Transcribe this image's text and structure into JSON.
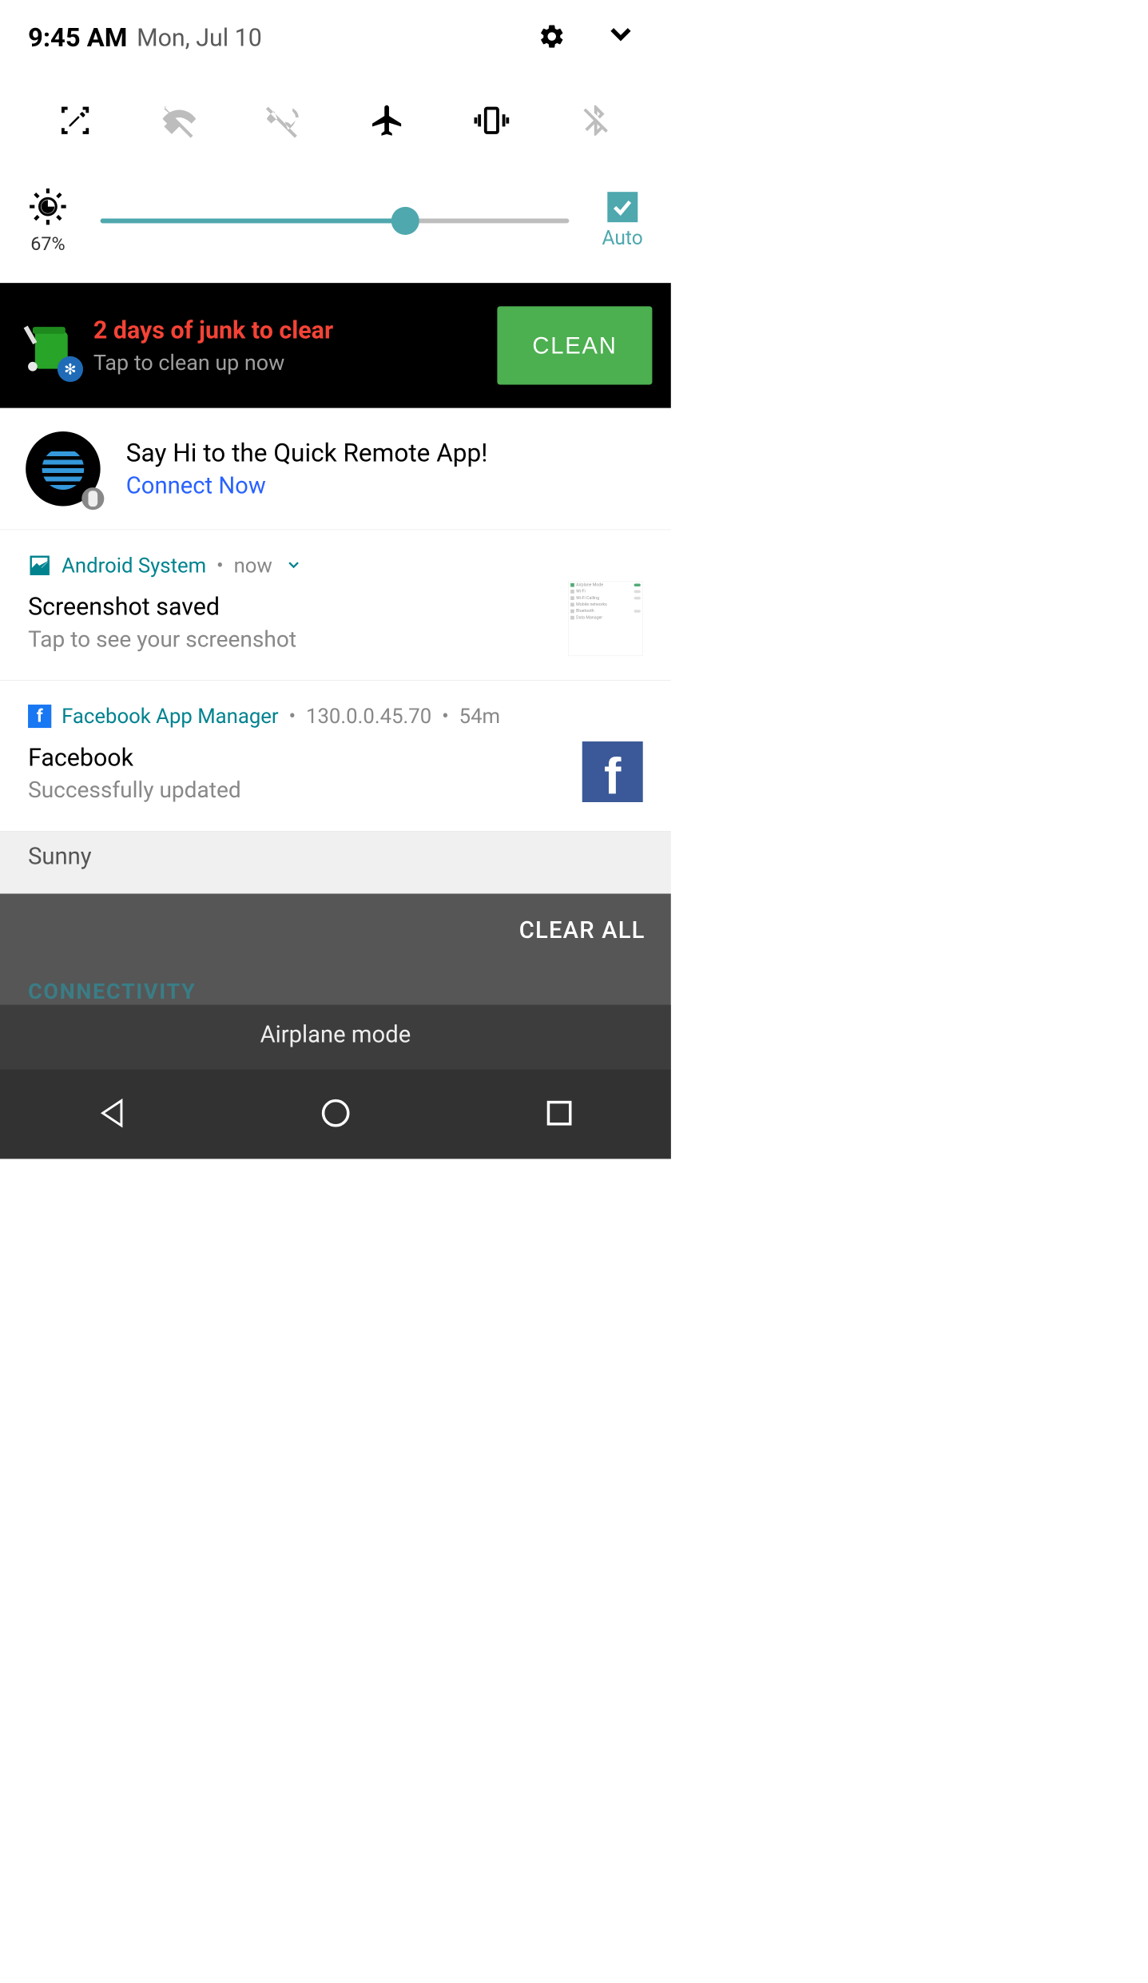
{
  "status_bar": {
    "time": "9:45 AM",
    "date": "Mon, Jul 10"
  },
  "brightness": {
    "percent_label": "67%",
    "percent_value": 65,
    "auto_label": "Auto",
    "auto_checked": true
  },
  "junk_card": {
    "title": "2 days of junk to clear",
    "subtitle": "Tap to clean up now",
    "button_label": "CLEAN"
  },
  "att_card": {
    "title": "Say Hi to the Quick Remote App!",
    "link": "Connect Now"
  },
  "notifications": [
    {
      "app_name": "Android System",
      "time": "now",
      "title": "Screenshot saved",
      "body": "Tap to see your screenshot"
    },
    {
      "app_name": "Facebook App Manager",
      "version": "130.0.0.45.70",
      "time": "54m",
      "title": "Facebook",
      "body": "Successfully updated"
    }
  ],
  "weather_peek": "Sunny",
  "clear_all_label": "CLEAR ALL",
  "settings_section_label": "CONNECTIVITY",
  "toast": "Airplane mode"
}
